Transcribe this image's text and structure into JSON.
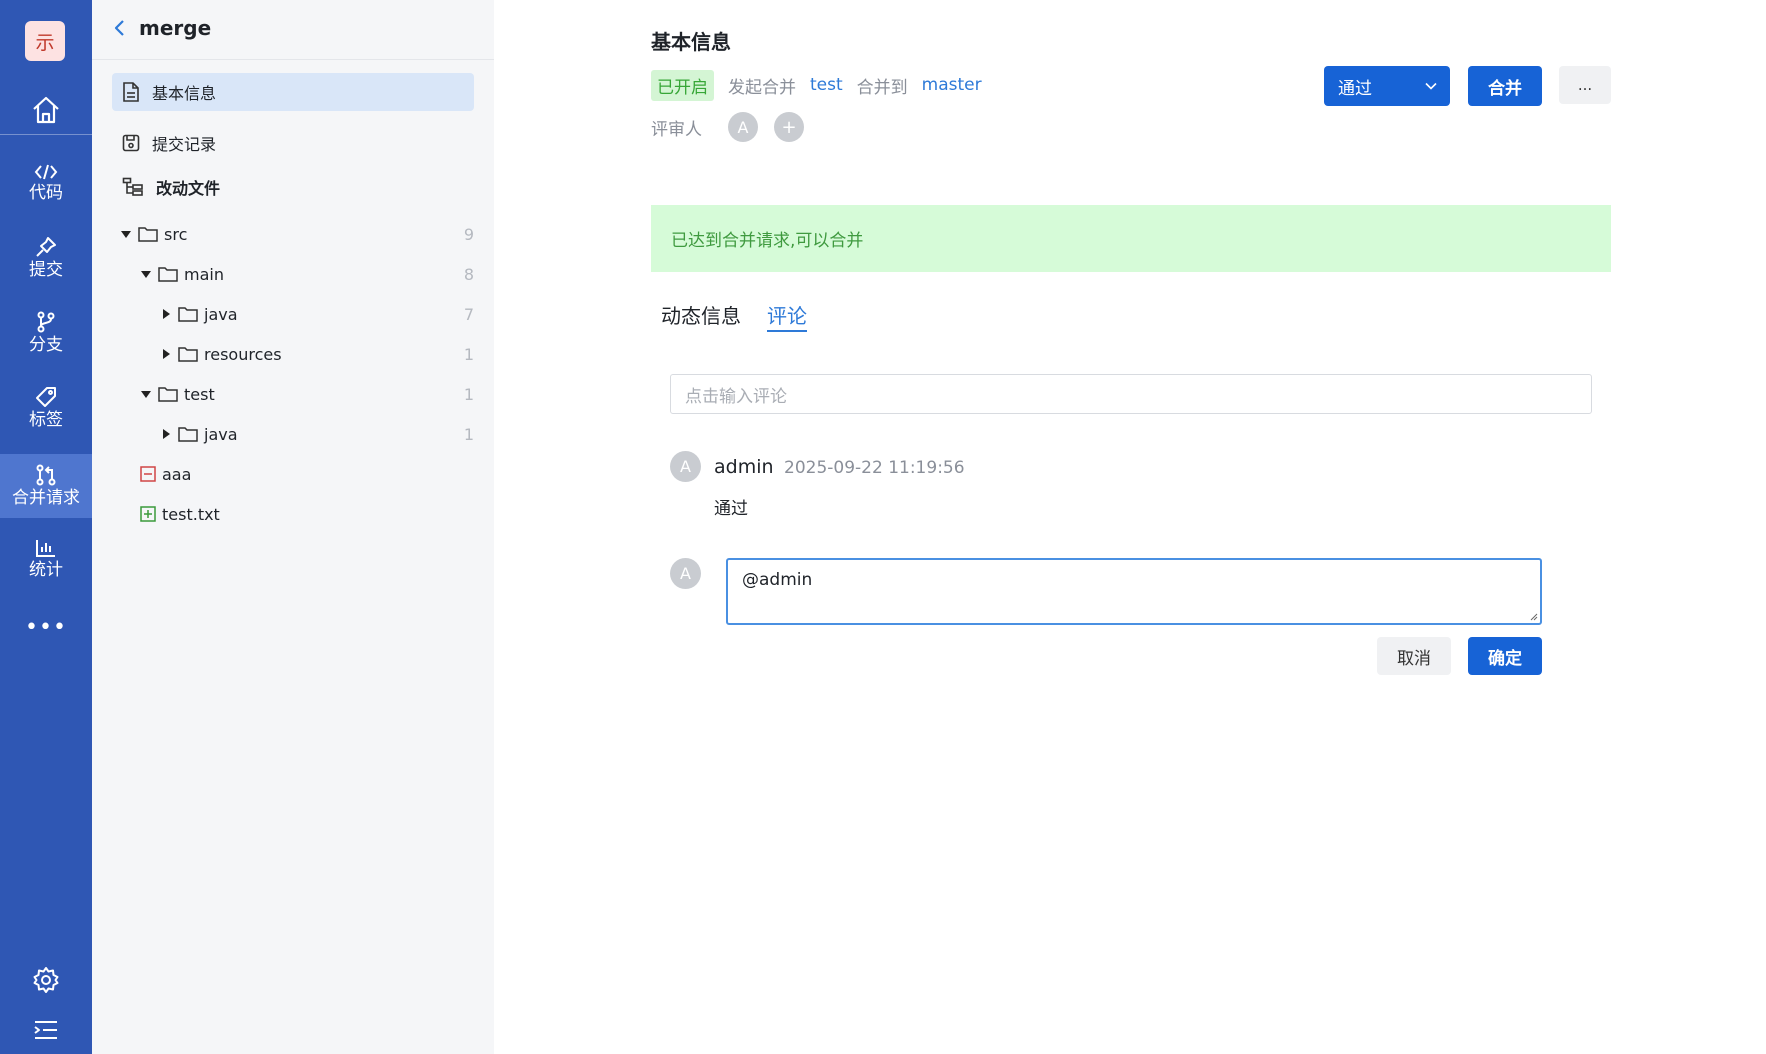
{
  "rail": {
    "logo": "示",
    "items": [
      {
        "label": "代码",
        "icon": "code-icon"
      },
      {
        "label": "提交",
        "icon": "pin-icon"
      },
      {
        "label": "分支",
        "icon": "branch-icon"
      },
      {
        "label": "标签",
        "icon": "tag-icon"
      },
      {
        "label": "合并请求",
        "icon": "merge-request-icon",
        "active": true
      },
      {
        "label": "统计",
        "icon": "chart-icon"
      }
    ],
    "more": "•••"
  },
  "sidebar": {
    "title": "merge",
    "menu": [
      {
        "label": "基本信息",
        "active": true
      },
      {
        "label": "提交记录"
      },
      {
        "label": "改动文件"
      }
    ],
    "tree": [
      {
        "name": "src",
        "count": "9"
      },
      {
        "name": "main",
        "count": "8"
      },
      {
        "name": "java",
        "count": "7"
      },
      {
        "name": "resources",
        "count": "1"
      },
      {
        "name": "test",
        "count": "1"
      },
      {
        "name": "java",
        "count": "1"
      },
      {
        "name": "aaa"
      },
      {
        "name": "test.txt"
      }
    ]
  },
  "main": {
    "title": "基本信息",
    "status_badge": "已开启",
    "initiated_label": "发起合并",
    "source_branch": "test",
    "merge_to_label": "合并到",
    "target_branch": "master",
    "reviewers_label": "评审人",
    "reviewer_avatar": "A",
    "add_reviewer": "+",
    "approve_button": "通过",
    "merge_button": "合并",
    "more_button": "...",
    "banner": "已达到合并请求,可以合并",
    "tabs": [
      "动态信息",
      "评论"
    ],
    "comment_placeholder": "点击输入评论",
    "comment": {
      "avatar": "A",
      "author": "admin",
      "time": "2025-09-22 11:19:56",
      "text": "通过"
    },
    "reply": {
      "avatar": "A",
      "value": "@admin",
      "cancel": "取消",
      "confirm": "确定"
    }
  },
  "colors": {
    "rail_bg": "#2f57b4",
    "primary": "#1763d6",
    "link": "#2e7ad8",
    "success_bg": "#d6fbd8",
    "success_text": "#3f9a3f"
  }
}
